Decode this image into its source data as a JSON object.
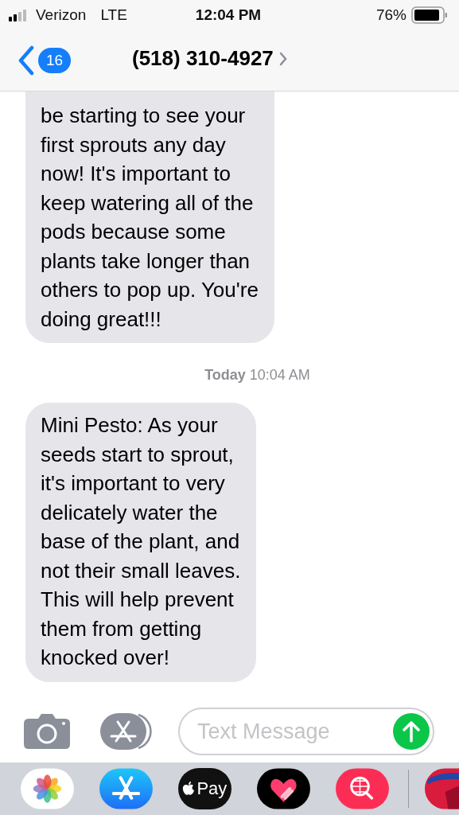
{
  "status_bar": {
    "carrier": "Verizon",
    "network": "LTE",
    "time": "12:04 PM",
    "battery": "76%"
  },
  "nav": {
    "unread_count": "16",
    "title": "(518) 310-4927"
  },
  "messages": [
    {
      "kind": "bubble",
      "text": "be starting to see your\nfirst sprouts any day\nnow! It's important to\nkeep watering all of the\npods because some\nplants take longer than\nothers to pop up. You're\ndoing great!!!"
    },
    {
      "kind": "timestamp",
      "day": "Today",
      "time": "10:04 AM"
    },
    {
      "kind": "bubble",
      "text": "Mini Pesto: As your\nseeds start to sprout,\nit's important to very\ndelicately water the\nbase of the plant, and\nnot their small leaves.\nThis will help prevent\nthem from getting\nknocked over!"
    }
  ],
  "composer": {
    "placeholder": "Text Message"
  },
  "apps": {
    "pay_label": "Pay"
  }
}
